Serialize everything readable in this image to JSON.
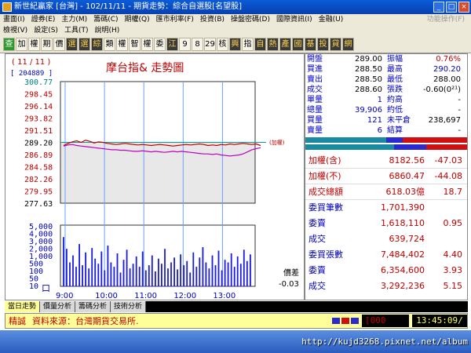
{
  "window": {
    "title": "新世紀贏家 [台灣] - 102/11/11 - 期貨走勢：綜合自選股[名望股]"
  },
  "menu": {
    "row1": [
      "畫面(I)",
      "證券(E)",
      "主力(M)",
      "籌碼(C)",
      "期權(Q)",
      "匯市利率(F)",
      "投資(B)",
      "操盤密碼(D)",
      "國際資訊(I)",
      "金融(U)",
      "功能操作(F)"
    ],
    "row1_right": "功能操作(F)",
    "row2": [
      "檢視(V)",
      "設定(S)",
      "工具(T)",
      "說明(H)"
    ]
  },
  "toolbar": {
    "buttons": [
      "查",
      "加",
      "權",
      "期",
      "價",
      "選",
      "選",
      "綜",
      "類",
      "權",
      "智",
      "權",
      "委",
      "江",
      "9",
      "8",
      "29",
      "核",
      "興",
      "指",
      "自",
      "熱",
      "產",
      "國",
      "基",
      "投",
      "貸",
      "網"
    ]
  },
  "chart": {
    "date": "( 11 / 11 )",
    "code": "[ 204889 ]",
    "title": "摩台指&  走勢圖",
    "note": "(加權)",
    "diff_label": "價差",
    "diff_value": "-0.03",
    "volume_unit": "口"
  },
  "chart_data": {
    "type": "line",
    "price_ticks": [
      "300.77",
      "298.45",
      "296.14",
      "293.82",
      "291.51",
      "289.20",
      "286.89",
      "284.58",
      "282.26",
      "279.95",
      "277.63"
    ],
    "price_ylim": [
      277.63,
      300.77
    ],
    "reference_price": 289.2,
    "volume_ticks": [
      "5,000",
      "4,000",
      "3,000",
      "2,000",
      "1,000",
      "500",
      "100",
      "50",
      "10"
    ],
    "x_ticks": [
      "9:00",
      "10:00",
      "11:00",
      "12:00",
      "13:00"
    ],
    "series": [
      {
        "color": "#c00000",
        "values": [
          288.6,
          289.0,
          289.3,
          289.5,
          289.2,
          289.6,
          289.4,
          289.1,
          289.3,
          289.2,
          289.0,
          288.9,
          288.8,
          288.9,
          289.0,
          288.9,
          288.8,
          288.7,
          288.8,
          288.7,
          288.6,
          288.7,
          288.8,
          288.7,
          288.6,
          288.5,
          288.6,
          288.7,
          288.8,
          288.7,
          288.8,
          288.9,
          288.8,
          288.6,
          288.7,
          288.6,
          288.8,
          288.7,
          288.9,
          288.8,
          288.9,
          289.0,
          288.9,
          288.8,
          288.9,
          288.6
        ]
      },
      {
        "color": "#c000c0",
        "values": [
          288.5,
          288.7,
          288.8,
          288.6,
          288.5,
          288.4,
          288.3,
          288.2,
          288.1,
          288.0,
          287.9,
          287.8,
          287.8,
          287.7,
          287.7,
          287.6,
          287.5,
          287.5,
          287.6,
          287.5,
          287.4,
          287.5,
          287.4,
          287.3,
          287.4,
          287.5,
          287.4,
          287.5,
          287.4,
          287.3,
          287.2,
          287.1,
          287.0,
          287.0,
          286.9,
          287.0,
          286.8,
          286.7,
          286.6,
          286.7,
          286.8,
          287.0,
          287.4,
          287.8,
          288.0,
          288.2
        ]
      }
    ],
    "volume": [
      3800,
      2200,
      900,
      1500,
      600,
      2800,
      700,
      1800,
      500,
      2300,
      1200,
      800,
      1900,
      400,
      2600,
      900,
      600,
      1700,
      300,
      1100,
      2100,
      500,
      800,
      1400,
      600,
      1900,
      400,
      700,
      1500,
      350,
      1200,
      800,
      2200,
      500,
      900,
      1300,
      450,
      1600,
      700,
      1000,
      300,
      1800,
      600,
      1300,
      2400,
      900,
      500,
      1500,
      700,
      2000,
      400,
      1100,
      900,
      1700,
      600,
      1400,
      800,
      2100,
      1000,
      1600
    ]
  },
  "quote": {
    "rows": [
      {
        "l1": "開盤",
        "v1": "289.00",
        "l2": "振幅",
        "v2": "0.76%"
      },
      {
        "l1": "買進",
        "v1": "288.50",
        "l2": "最高",
        "v2": "290.20"
      },
      {
        "l1": "賣出",
        "v1": "288.50",
        "l2": "最低",
        "v2": "288.00"
      },
      {
        "l1": "成交",
        "v1": "288.60",
        "l2": "張跌",
        "v2": "-0.60(0²¹)"
      },
      {
        "l1": "單量",
        "v1": "1",
        "l2": "約高",
        "v2": "-"
      },
      {
        "l1": "總量",
        "v1": "39,906",
        "l2": "約低",
        "v2": "-"
      },
      {
        "l1": "買量",
        "v1": "121",
        "l2": "未平倉",
        "v2": "238,697"
      },
      {
        "l1": "賣量",
        "v1": "6",
        "l2": "結算",
        "v2": "-"
      }
    ]
  },
  "index": {
    "rows": [
      {
        "label": "加權(含)",
        "v1": "8182.56",
        "v2": "-47.03"
      },
      {
        "label": "加權(不)",
        "v1": "6860.47",
        "v2": "-44.08"
      },
      {
        "label": "成交總額",
        "v1": "618.03億",
        "v2": "18.7"
      }
    ]
  },
  "orders": {
    "rows": [
      {
        "label": "委買筆數",
        "v1": "1,701,390",
        "v2": ""
      },
      {
        "label": "委賣",
        "v1": "1,618,110",
        "v2": "0.95"
      },
      {
        "label": "成交",
        "v1": "639,724",
        "v2": ""
      },
      {
        "label": "委買張數",
        "v1": "7,484,402",
        "v2": "4.40"
      },
      {
        "label": "委賣",
        "v1": "6,354,600",
        "v2": "3.93"
      },
      {
        "label": "成交",
        "v1": "3,292,236",
        "v2": "5.15"
      }
    ]
  },
  "tabs": [
    "當日走勢",
    "價量分析",
    "籌碼分析",
    "技術分析"
  ],
  "status": {
    "tag": "精誠",
    "source": "資料來源：台灣期貨交易所.",
    "count": "[000",
    "clock": "13:45:09/"
  },
  "taskbar": {
    "url": "http://kujd3268.pixnet.net/album"
  },
  "colors": {
    "up": "#c00000",
    "down": "#0000c0",
    "volume": "#1a1ae6",
    "avg_line": "#c000c0"
  }
}
